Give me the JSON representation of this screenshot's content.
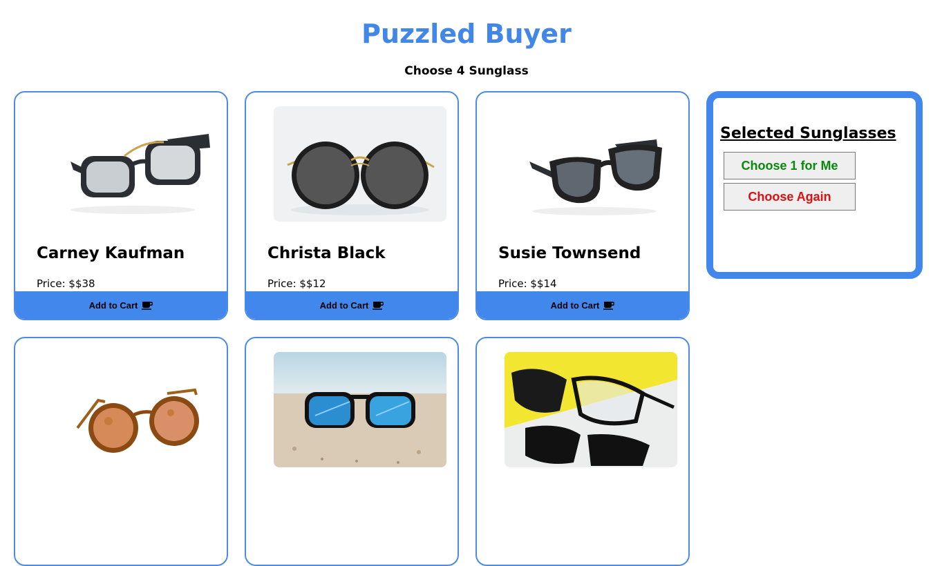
{
  "header": {
    "title": "Puzzled Buyer",
    "subtitle": "Choose 4 Sunglass"
  },
  "products": [
    {
      "name": "Carney Kaufman",
      "price": "Price: $$38",
      "cart_label": "Add to Cart",
      "image": "black-square-frame-sunglasses"
    },
    {
      "name": "Christa Black",
      "price": "Price: $$12",
      "cart_label": "Add to Cart",
      "image": "round-gold-rim-sunglasses"
    },
    {
      "name": "Susie Townsend",
      "price": "Price: $$14",
      "cart_label": "Add to Cart",
      "image": "black-cat-eye-sunglasses"
    },
    {
      "image": "tortoise-round-sunglasses"
    },
    {
      "image": "blue-mirror-sunglasses-on-sand"
    },
    {
      "image": "clip-on-glasses-on-yellow"
    }
  ],
  "selected_panel": {
    "title": "Selected Sunglasses",
    "choose_one_label": "Choose 1 for Me",
    "choose_again_label": "Choose Again"
  },
  "colors": {
    "accent": "#4287eb",
    "title": "#4286e8",
    "choose_one": "#0a8a0a",
    "choose_again": "#e01010"
  },
  "icons": {
    "cart_button": "coffee-cup-icon"
  }
}
